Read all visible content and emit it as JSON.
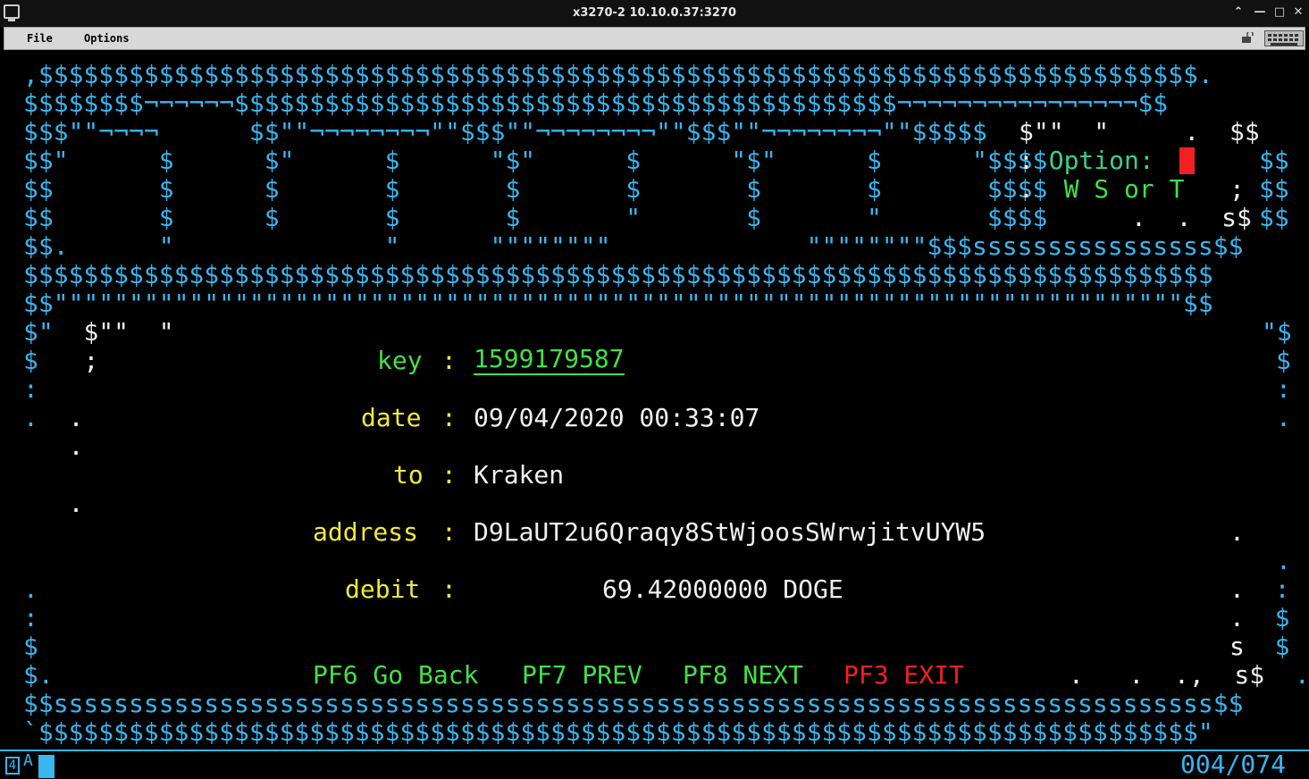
{
  "window": {
    "title": "x3270-2 10.10.0.37:3270"
  },
  "menubar": {
    "items": [
      "File",
      "Options"
    ]
  },
  "screen": {
    "banner": [
      ",$$$$$$$$$$$$$$$$$$$$$$$$$$$$$$$$$$$$$$$$$$$$$$$$$$$$$$$$$$$$$$$$$$$$$$$$$$$$$.",
      "$$$$$$$$¬¬¬¬¬¬$$$$$$$$$$$$$$$$$$$$$$$$$$$$$$$$$$$$$$$$$$$$¬¬¬¬¬¬¬¬¬¬¬¬¬¬¬¬$$",
      "$$$\"\"¬¬¬¬      $$\"\"¬¬¬¬¬¬¬¬\"\"$$$\"\"¬¬¬¬¬¬¬¬\"\"$$$\"\"¬¬¬¬¬¬¬¬\"\"$$$$$",
      "$$\"      $      $\"      $      \"$\"      $      \"$\"      $      \"$$$$",
      "$$       $      $       $       $       $       $       $       $$$$",
      "$$       $      $       $       $       \"       $       \"       $$$$",
      "$$.      \"              \"      \"\"\"\"\"\"\"\"             \"\"\"\"\"\"\"\"$$$ssssssssssssssss$$",
      "$$$$$$$$$$$$$$$$$$$$$$$$$$$$$$$$$$$$$$$$$$$$$$$$$$$$$$$$$$$$$$$$$$$$$$$$$$$$$$$",
      "$$\"\"\"\"\"\"\"\"\"\"\"\"\"\"\"\"\"\"\"\"\"\"\"\"\"\"\"\"\"\"\"\"\"\"\"\"\"\"\"\"\"\"\"\"\"\"\"\"\"\"\"\"\"\"\"\"\"\"\"\"\"\"\"\"\"\"\"\"\"\"\"\"\"\"\"$$"
    ],
    "art_right": {
      "r2": "$\"\"  \"     .  $$",
      "r3a": ": ",
      "r3_option": "Option: ",
      "r3b": "    $$",
      "r4a": ".  ",
      "r4_menu": "W S or T",
      "r4b": "  ;  $$",
      "r5": "    .   .  s$  $$"
    },
    "left_art": {
      "r9": "$\"  $\"\"  \"",
      "r9r": "\"$",
      "r10": "$   ;",
      "r10r": "$",
      "r11": ":",
      "r11r": ":",
      "r12": ".  .",
      "r12r": ".",
      "r13": "   .",
      "r15": "   .",
      "r16r": ".",
      "r17r": ".",
      "r18": ".",
      "r18r": ".  :",
      "r19": ":",
      "r19r": ".  $",
      "r20": "$",
      "r20r": "s  $",
      "r21": "$.",
      "r21r": ".   .  .,  s$  .$"
    },
    "fields": {
      "key_label": "key",
      "key_value": "1599179587",
      "date_label": "date",
      "date_value": "09/04/2020 00:33:07",
      "to_label": "to",
      "to_value": "Kraken",
      "address_label": "address",
      "address_value": "D9LaUT2u6Qraqy8StWjoosSWrwjitvUYW5",
      "debit_label": "debit",
      "debit_value": "69.42000000 DOGE",
      "sep": ":"
    },
    "pfkeys": {
      "pf6": "PF6 Go Back",
      "pf7": "PF7 PREV",
      "pf8": "PF8 NEXT",
      "pf3": "PF3 EXIT"
    },
    "footer": [
      "$$sssssssssssssssssssssssssssssssssssssssssssssssssssssssssssssssssssssssssssss$$",
      "`$$$$$$$$$$$$$$$$$$$$$$$$$$$$$$$$$$$$$$$$$$$$$$$$$$$$$$$$$$$$$$$$$$$$$$$$$$$$$\""
    ]
  },
  "oia": {
    "indicator": "4",
    "mode": "A",
    "position": "004/074"
  },
  "colors": {
    "blue": "#38b6f0",
    "green": "#42e04a",
    "yellow": "#f2e83a",
    "red": "#f22020",
    "white": "#f0f0f0"
  }
}
